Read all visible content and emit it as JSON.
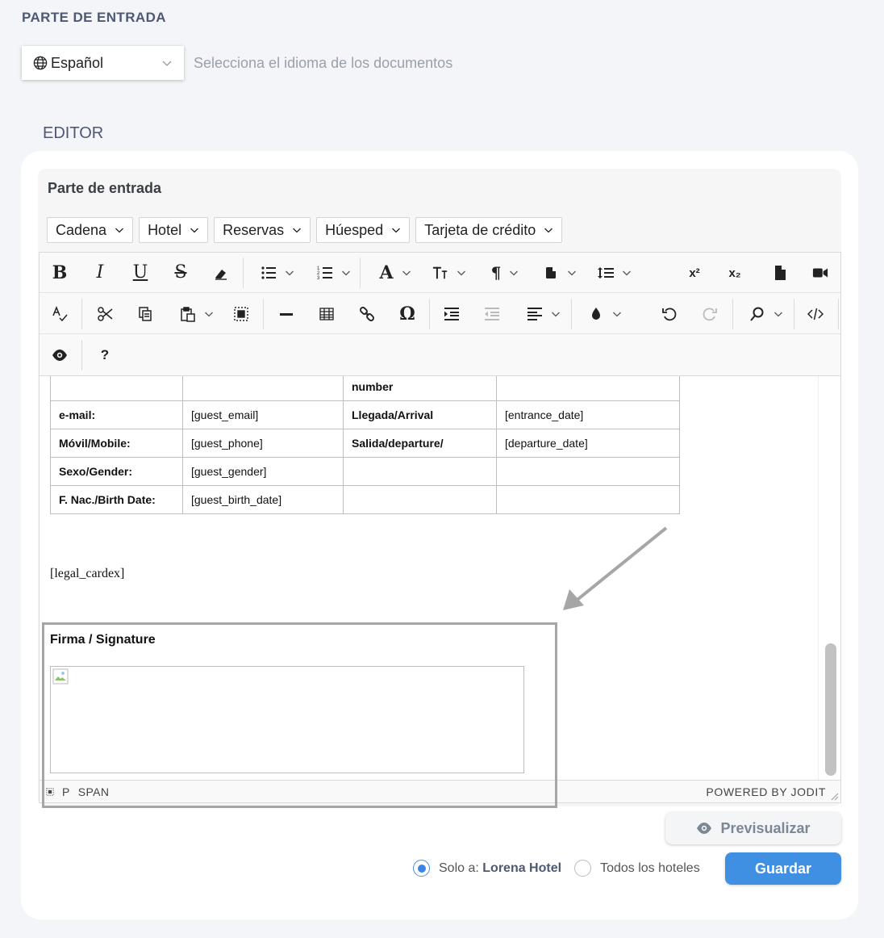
{
  "header": {
    "section_title": "PARTE DE ENTRADA",
    "language_value": "Español",
    "language_hint": "Selecciona el idioma de los documentos",
    "editor_label": "EDITOR"
  },
  "document": {
    "title": "Parte de entrada",
    "variable_menus": [
      "Cadena",
      "Hotel",
      "Reservas",
      "Húesped",
      "Tarjeta de crédito"
    ]
  },
  "toolbar": {
    "icons": [
      "bold-icon",
      "italic-icon",
      "underline-icon",
      "strikethrough-icon",
      "eraser-icon",
      "unordered-list-icon",
      "ordered-list-icon",
      "font-icon",
      "font-size-icon",
      "paragraph-icon",
      "classname-icon",
      "line-height-icon",
      "superscript-icon",
      "subscript-icon",
      "file-icon",
      "video-icon",
      "spellcheck-icon",
      "cut-icon",
      "copy-icon",
      "paste-icon",
      "select-all-icon",
      "horizontal-rule-icon",
      "table-icon",
      "link-icon",
      "symbol-icon",
      "indent-icon",
      "outdent-icon",
      "align-icon",
      "brush-icon",
      "undo-icon",
      "redo-icon",
      "find-icon",
      "source-icon",
      "preview-icon",
      "help-icon"
    ],
    "help_glyph": "?",
    "superscript_glyph": "x²",
    "subscript_glyph": "x₂"
  },
  "content": {
    "table_rows": [
      [
        "",
        "",
        "number",
        ""
      ],
      [
        "e-mail:",
        "[guest_email]",
        "Llegada/Arrival",
        "[entrance_date]"
      ],
      [
        "Móvil/Mobile:",
        "[guest_phone]",
        "Salida/departure/",
        "[departure_date]"
      ],
      [
        "Sexo/Gender:",
        "[guest_gender]",
        "",
        ""
      ],
      [
        "F. Nac./Birth Date:",
        "[guest_birth_date]",
        "",
        ""
      ]
    ],
    "legal": "[legal_cardex]",
    "signature_title": "Firma / Signature"
  },
  "statusbar": {
    "path": [
      "P",
      "SPAN"
    ],
    "powered": "POWERED BY JODIT"
  },
  "actions": {
    "preview_label": "Previsualizar",
    "scope_only_prefix": "Solo a:",
    "scope_only_hotel": "Lorena Hotel",
    "scope_all": "Todos los hoteles",
    "save_label": "Guardar"
  },
  "colors": {
    "accent": "#3f8fe3",
    "heading": "#4e5873",
    "page_bg": "#f3f5f9"
  }
}
